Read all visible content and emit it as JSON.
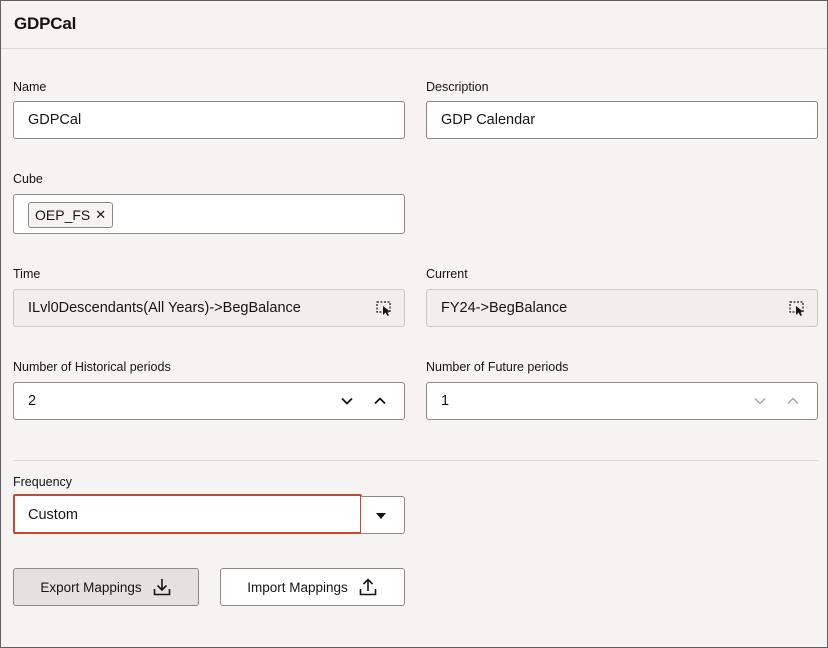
{
  "header": {
    "title": "GDPCal"
  },
  "name": {
    "label": "Name",
    "value": "GDPCal"
  },
  "description": {
    "label": "Description",
    "value": "GDP Calendar"
  },
  "cube": {
    "label": "Cube",
    "chips": [
      "OEP_FS"
    ],
    "remove_glyph": "✕"
  },
  "time": {
    "label": "Time",
    "value": "ILvl0Descendants(All Years)->BegBalance",
    "icon": "member-selector-icon"
  },
  "current": {
    "label": "Current",
    "value": "FY24->BegBalance",
    "icon": "member-selector-icon"
  },
  "historical": {
    "label": "Number of Historical periods",
    "value": "2"
  },
  "future": {
    "label": "Number of Future periods",
    "value": "1"
  },
  "frequency": {
    "label": "Frequency",
    "value": "Custom",
    "highlight_color": "#c74634"
  },
  "buttons": {
    "export_label": "Export Mappings",
    "import_label": "Import Mappings"
  },
  "colors": {
    "border": "#8d8a85",
    "background": "#f5f4f2",
    "text": "#161513"
  }
}
